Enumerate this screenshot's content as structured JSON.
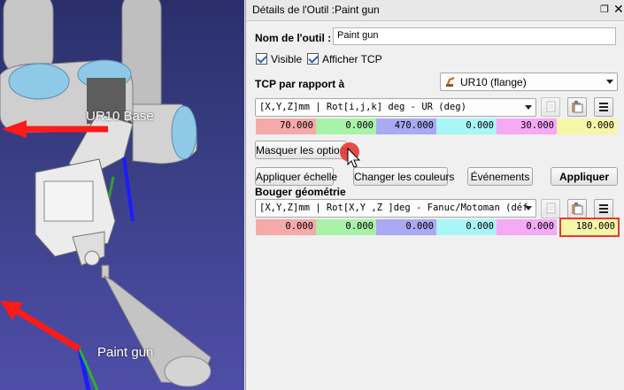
{
  "viewport": {
    "base_label": "UR10 Base",
    "tool_label": "Paint gun"
  },
  "panel": {
    "title": "Détails de l'Outil :Paint gun",
    "tool_name_label": "Nom de l'outil :",
    "tool_name_value": "Paint gun",
    "visible_label": "Visible",
    "show_tcp_label": "Afficher TCP",
    "tcp_relative_label": "TCP par rapport à",
    "robot_select_value": "UR10 (flange)",
    "tcp_format": "[X,Y,Z]mm | Rot[i,j,k] deg   - UR (deg)",
    "tcp_values": [
      "70.000",
      "0.000",
      "470.000",
      "0.000",
      "30.000",
      "0.000"
    ],
    "hide_options_label": "Masquer les options",
    "apply_scale_label": "Appliquer échelle",
    "change_colors_label": "Changer les couleurs",
    "events_label": "Événements",
    "apply_label": "Appliquer",
    "move_geometry_label": "Bouger géométrie",
    "geom_format": "[X,Y,Z]mm | Rot[X,Y ,Z  ]deg - Fanuc/Motoman (déf",
    "geom_values": [
      "0.000",
      "0.000",
      "0.000",
      "0.000",
      "0.000",
      "180.000"
    ],
    "value_colors": [
      "#f6a9a9",
      "#a9f3a9",
      "#a9a9f4",
      "#a9f6f6",
      "#f6a9f6",
      "#f6f6a9"
    ],
    "highlight_color": "#e53935"
  }
}
